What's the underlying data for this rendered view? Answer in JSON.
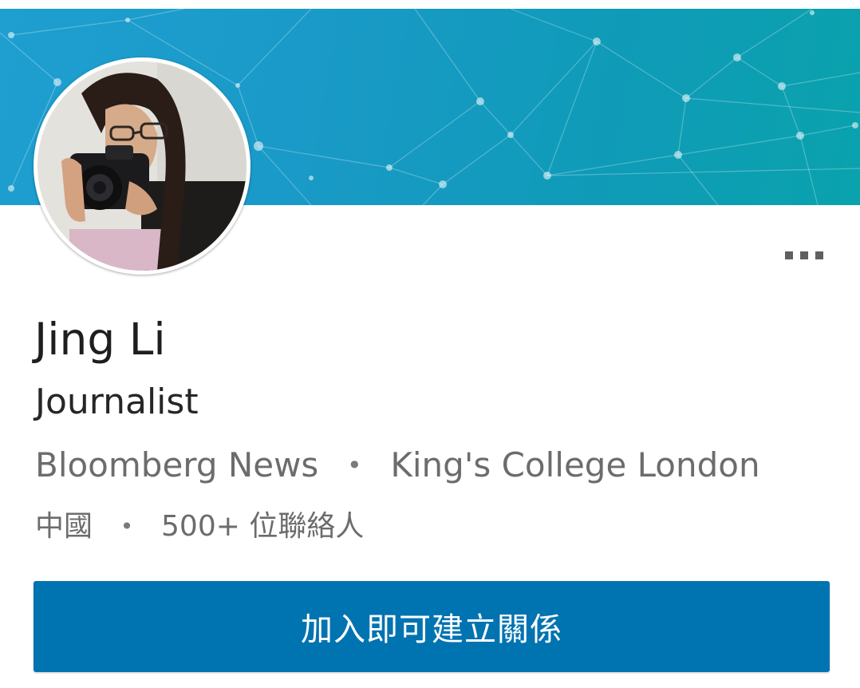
{
  "profile": {
    "name": "Jing Li",
    "headline": "Journalist",
    "company": "Bloomberg News",
    "school": "King's College London",
    "location": "中國",
    "connections": "500+ 位聯絡人",
    "separator": "•"
  },
  "actions": {
    "connect_label": "加入即可建立關係",
    "more_icon": "more-horizontal-icon"
  },
  "colors": {
    "banner_start": "#1e9fd0",
    "banner_end": "#0aa2ad",
    "button": "#0073b1",
    "name_text": "#1e1e1e",
    "secondary_text": "#6c6c6c"
  }
}
